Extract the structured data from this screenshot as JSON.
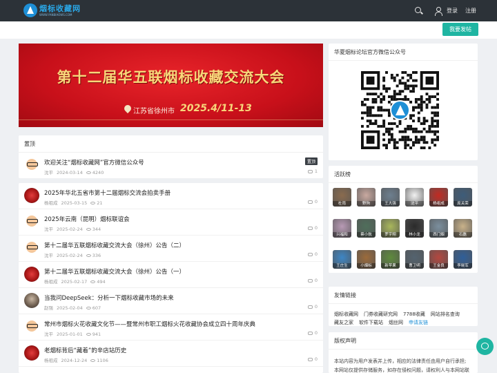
{
  "header": {
    "logo_cn": "烟标收藏网",
    "logo_url": "WWW.YANBIAOWS.COM",
    "login": "登录",
    "register": "注册",
    "post_button": "我要发帖"
  },
  "banner": {
    "title": "第十二届华五联烟标收藏交流大会",
    "place": "江苏省徐州市",
    "date": "2025.4/11-13"
  },
  "pinned": {
    "heading": "置顶",
    "badge": "置顶",
    "item": {
      "title": "欢迎关注“烟标收藏网”官方微信公众号",
      "author": "沈平",
      "date": "2024-03-14",
      "views": "4240",
      "comments": "1"
    }
  },
  "posts": [
    {
      "title": "2025年华北五省市第十二届烟标交流会拍卖手册",
      "author": "杨祖成",
      "date": "2025-03-15",
      "views": "21",
      "comments": "0",
      "avatar": "red"
    },
    {
      "title": "2025年云南（昆明）烟标联谊会",
      "author": "沈平",
      "date": "2025-02-24",
      "views": "344",
      "comments": "0",
      "avatar": "cartoon"
    },
    {
      "title": "第十二届华五联烟标收藏交流大会（徐州）公告（二）",
      "author": "沈平",
      "date": "2025-02-24",
      "views": "336",
      "comments": "0",
      "avatar": "cartoon"
    },
    {
      "title": "第十二届华五联烟标收藏交流大会（徐州）公告（一）",
      "author": "杨祖成",
      "date": "2025-02-17",
      "views": "494",
      "comments": "0",
      "avatar": "red"
    },
    {
      "title": "当我问DeepSeek：分析一下烟标收藏市场的未来",
      "author": "赵强",
      "date": "2025-02-04",
      "views": "607",
      "comments": "0",
      "avatar": "photo"
    },
    {
      "title": "常州市烟标火花收藏文化节——暨常州市职工烟标火花收藏协会成立四十周年庆典",
      "author": "沈平",
      "date": "2025-01-01",
      "views": "941",
      "comments": "0",
      "avatar": "cartoon"
    },
    {
      "title": "老烟标背后“藏着”的辛店站历史",
      "author": "杨祖成",
      "date": "2024-12-24",
      "views": "1106",
      "comments": "0",
      "avatar": "red"
    }
  ],
  "sidebar": {
    "wechat_title": "华夏烟标论坛官方微信公众号",
    "active_title": "活跃榜",
    "active_users": [
      {
        "name": "杜雨",
        "color": "#8a6b4e"
      },
      {
        "name": "野狗",
        "color": "#c9a9a0"
      },
      {
        "name": "王大强",
        "color": "#6d7f8f"
      },
      {
        "name": "沈平",
        "color": "#f1f1f1"
      },
      {
        "name": "杨祖成",
        "color": "#c22a22"
      },
      {
        "name": "庞关荣",
        "color": "#3d5c7a"
      },
      {
        "name": "兴福和",
        "color": "#b89ab5"
      },
      {
        "name": "蔡小航",
        "color": "#4f6e5b"
      },
      {
        "name": "罗宇翔",
        "color": "#a9b75b"
      },
      {
        "name": "林小龙",
        "color": "#2b2b2b"
      },
      {
        "name": "西门烟",
        "color": "#7b8f9e"
      },
      {
        "name": "石磊",
        "color": "#c9b28a"
      },
      {
        "name": "王庄生",
        "color": "#3d86c5"
      },
      {
        "name": "小烟标",
        "color": "#9c6b3b"
      },
      {
        "name": "新苹果",
        "color": "#5e8a3c"
      },
      {
        "name": "曹卫明",
        "color": "#54636f"
      },
      {
        "name": "王金良",
        "color": "#b4473f"
      },
      {
        "name": "李晓军",
        "color": "#2f5f9a"
      }
    ],
    "links_title": "友情链接",
    "links": [
      "烟标收藏网",
      "门券收藏研究网",
      "7788收藏",
      "网站排名查询",
      "藏友之家",
      "软件下载站",
      "烟丝网"
    ],
    "apply_link": "申请友链",
    "copyright_title": "版权声明",
    "copyright_lines": [
      "本站内容为用户发表并上传，相应的法律责任由用户自行承担;",
      "本网站仅提供存储服务，如存在侵权问题，请权利人与本网站联"
    ]
  }
}
